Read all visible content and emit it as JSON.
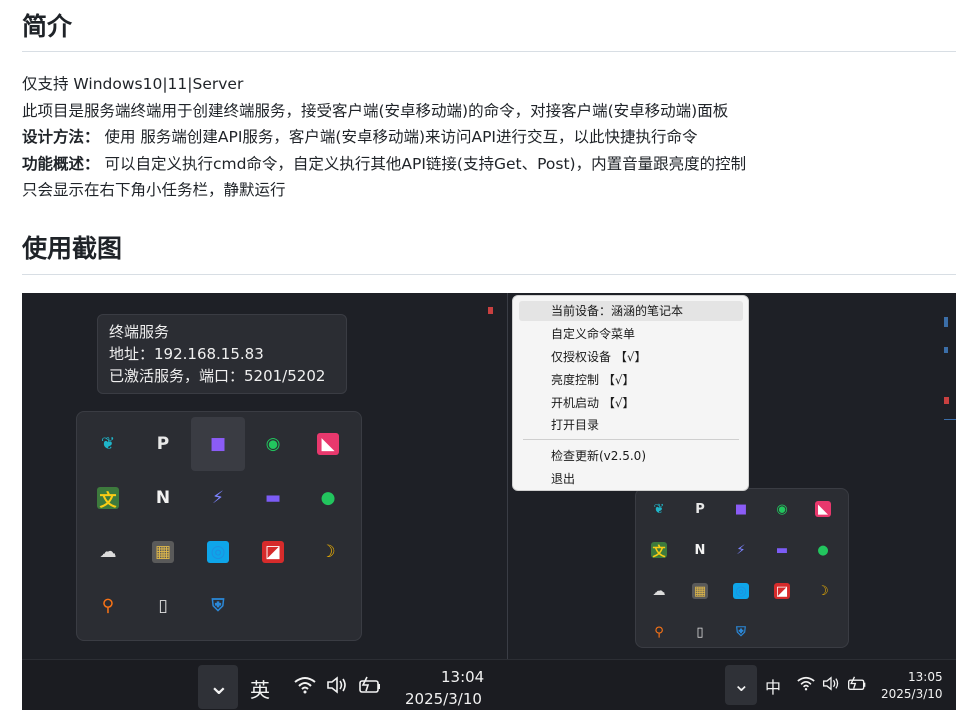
{
  "section1": {
    "title": "简介"
  },
  "intro": {
    "line1": "仅支持 Windows10|11|Server",
    "line2": "此项目是服务端终端用于创建终端服务，接受客户端(安卓移动端)的命令，对接客户端(安卓移动端)面板",
    "design_label": "设计方法：",
    "design_text": " 使用 服务端创建API服务，客户端(安卓移动端)来访问API进行交互，以此快捷执行命令",
    "feature_label": "功能概述：",
    "feature_text": " 可以自定义执行cmd命令，自定义执行其他API链接(支持Get、Post)，内置音量跟亮度的控制",
    "line5": "只会显示在右下角小任务栏，静默运行"
  },
  "section2": {
    "title": "使用截图"
  },
  "tooltip": {
    "line1": "终端服务",
    "line2": "地址：192.168.15.83",
    "line3": "已激活服务，端口：5201/5202"
  },
  "tray_icons": [
    {
      "name": "bird-icon",
      "glyph": "❦",
      "color": "#1fb5c9",
      "bg": "transparent"
    },
    {
      "name": "p-bracket-icon",
      "glyph": "P",
      "color": "#e8e8e8",
      "bg": "transparent"
    },
    {
      "name": "purple-app-icon",
      "glyph": "■",
      "color": "#8b5cf6",
      "bg": "transparent"
    },
    {
      "name": "green-speedometer-icon",
      "glyph": "◉",
      "color": "#22c55e",
      "bg": "transparent"
    },
    {
      "name": "pink-app-icon",
      "glyph": "◣",
      "color": "#ffffff",
      "bg": "#e8386d"
    },
    {
      "name": "translate-icon",
      "glyph": "文",
      "color": "#facc15",
      "bg": "#3d7a3d"
    },
    {
      "name": "n-wave-icon",
      "glyph": "N",
      "color": "#f2f2f2",
      "bg": "transparent"
    },
    {
      "name": "feather-icon",
      "glyph": "⚡",
      "color": "#7c83ff",
      "bg": "transparent"
    },
    {
      "name": "monitor-icon",
      "glyph": "▬",
      "color": "#7c5cf6",
      "bg": "transparent"
    },
    {
      "name": "wechat-icon",
      "glyph": "●",
      "color": "#22c55e",
      "bg": "transparent"
    },
    {
      "name": "cloud-sync-icon",
      "glyph": "☁",
      "color": "#dcdcdc",
      "bg": "transparent"
    },
    {
      "name": "palette-icon",
      "glyph": "▦",
      "color": "#e0b84a",
      "bg": "#5a5a5a"
    },
    {
      "name": "speaker-icon",
      "glyph": "◎",
      "color": "#1f8fe0",
      "bg": "#0ea5e9"
    },
    {
      "name": "amd-icon",
      "glyph": "◪",
      "color": "#ffffff",
      "bg": "#d62b2b"
    },
    {
      "name": "moon-sun-icon",
      "glyph": "☽",
      "color": "#f4b400",
      "bg": "transparent"
    },
    {
      "name": "search-key-icon",
      "glyph": "⚲",
      "color": "#f97316",
      "bg": "transparent"
    },
    {
      "name": "usb-drive-icon",
      "glyph": "▯",
      "color": "#e0e0e0",
      "bg": "transparent"
    },
    {
      "name": "shield-warning-icon",
      "glyph": "⛨",
      "color": "#2b88d8",
      "bg": "transparent"
    }
  ],
  "taskbar_left": {
    "chevron": "⌄",
    "ime": "英",
    "time": "13:04",
    "date": "2025/3/10"
  },
  "taskbar_right": {
    "chevron": "⌄",
    "ime": "中",
    "time": "13:05",
    "date": "2025/3/10"
  },
  "context_menu": {
    "items": [
      "当前设备：涵涵的笔记本",
      "自定义命令菜单",
      "仅授权设备 【√】",
      "亮度控制 【√】",
      "开机启动 【√】",
      "打开目录",
      "检查更新(v2.5.0)",
      "退出"
    ]
  }
}
